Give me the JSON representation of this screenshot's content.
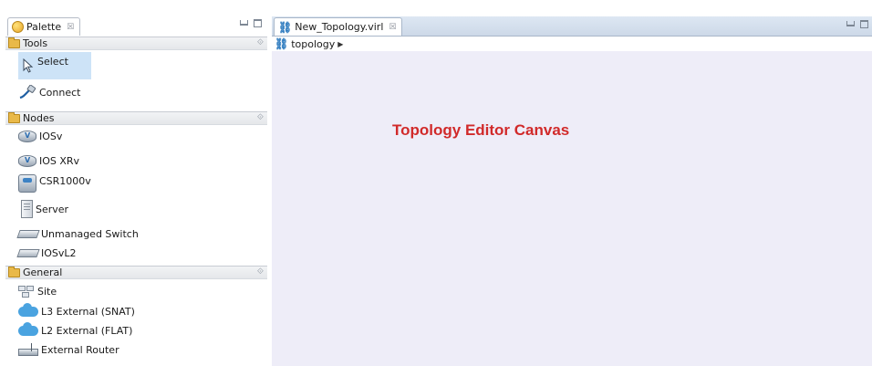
{
  "palette": {
    "tab_title": "Palette",
    "tab_close": "☒",
    "icons": {
      "palette_tab": "palette-icon"
    },
    "drawers": {
      "tools": {
        "title": "Tools",
        "items": [
          {
            "label": "Select",
            "icon": "cursor-icon",
            "selected": true
          },
          {
            "label": "Connect",
            "icon": "connect-cable-icon"
          }
        ]
      },
      "nodes": {
        "title": "Nodes",
        "items": [
          {
            "label": "IOSv",
            "icon": "router-icon"
          },
          {
            "label": "IOS XRv",
            "icon": "router-xr-icon"
          },
          {
            "label": "CSR1000v",
            "icon": "csr-router-icon"
          },
          {
            "label": "Server",
            "icon": "server-icon"
          },
          {
            "label": "Unmanaged Switch",
            "icon": "switch-icon"
          },
          {
            "label": "IOSvL2",
            "icon": "l2-switch-icon"
          }
        ]
      },
      "general": {
        "title": "General",
        "items": [
          {
            "label": "Site",
            "icon": "site-icon"
          },
          {
            "label": "L3 External (SNAT)",
            "icon": "cloud-icon"
          },
          {
            "label": "L2 External (FLAT)",
            "icon": "cloud-icon"
          },
          {
            "label": "External Router",
            "icon": "external-router-icon"
          }
        ]
      }
    }
  },
  "editor": {
    "tab_title": "New_Topology.virl",
    "tab_close": "☒",
    "breadcrumb": "topology",
    "canvas_caption": "Topology Editor Canvas"
  },
  "colors": {
    "canvas_bg": "#eeedf8",
    "caption": "#d12a2a",
    "selection": "#cde3f7"
  }
}
